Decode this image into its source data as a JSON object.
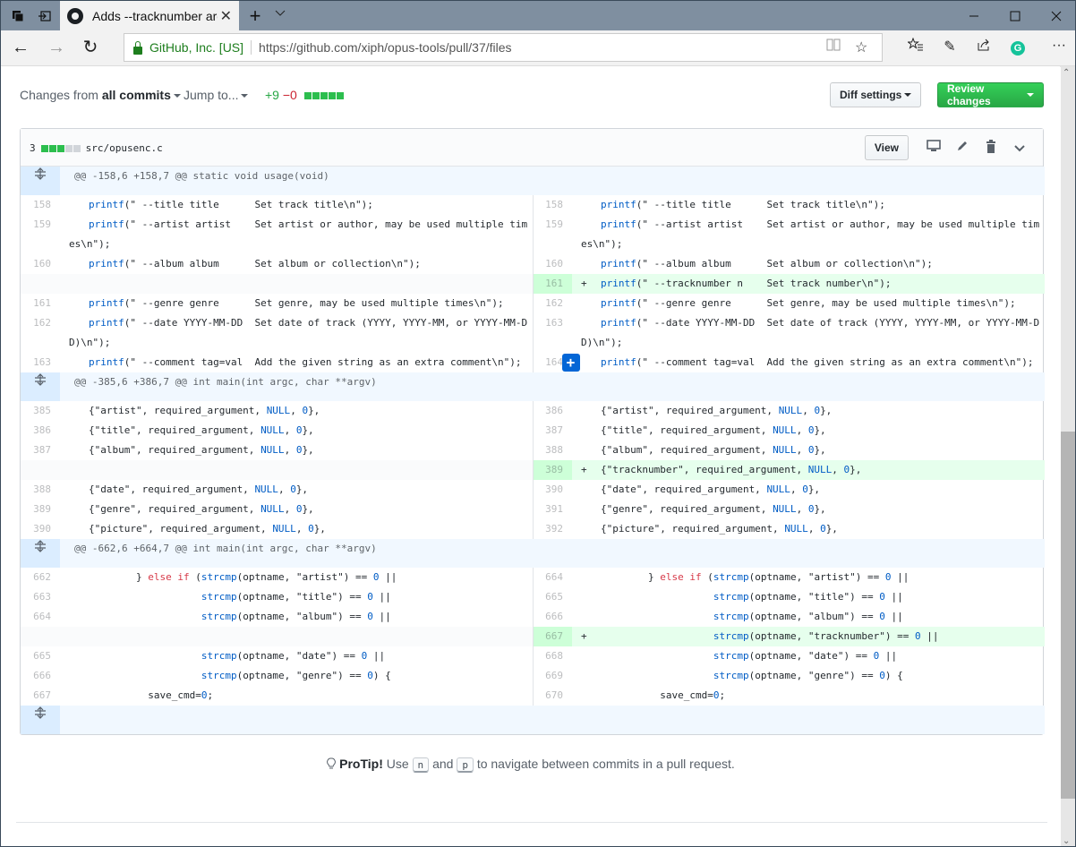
{
  "browser": {
    "tab_title": "Adds --tracknumber arg",
    "cert_label": "GitHub, Inc. [US]",
    "url": "https://github.com/xiph/opus-tools/pull/37/files",
    "icons": {
      "tab_manager": "tab-manager-icon",
      "set_aside": "set-aside-icon",
      "new_tab": "+",
      "tab_menu": "∨",
      "minimize": "—",
      "maximize": "□",
      "close": "✕",
      "back": "←",
      "forward": "→",
      "refresh": "↻",
      "reading_view": "📖",
      "favorite": "☆",
      "favorites_hub": "★",
      "notes": "✎",
      "share": "↪",
      "grammarly": "G",
      "more": "···"
    }
  },
  "toolbar": {
    "changes_prefix": "Changes from",
    "changes_value": "all commits",
    "jump_to": "Jump to...",
    "additions": "+9",
    "deletions": "−0",
    "diff_settings": "Diff settings",
    "review_changes": "Review changes"
  },
  "file": {
    "change_count": "3",
    "path": "src/opusenc.c",
    "view_button": "View",
    "stat_blocks": {
      "added": 3,
      "neutral": 2
    }
  },
  "hunks": [
    {
      "header": "@@ -158,6 +158,7 @@ static void usage(void)",
      "rows": [
        {
          "l": "158",
          "lc": [
            [
              "kw",
              "printf"
            ],
            [
              "",
              "(\" --title title      Set track title\\n\");"
            ]
          ],
          "r": "158",
          "rc": [
            [
              "kw",
              "printf"
            ],
            [
              "",
              "(\" --title title      Set track title\\n\");"
            ]
          ],
          "type": "ctx"
        },
        {
          "l": "159",
          "lc": [
            [
              "kw",
              "printf"
            ],
            [
              "",
              "(\" --artist artist    Set artist or author, may be used multiple times\\n\");"
            ]
          ],
          "r": "159",
          "rc": [
            [
              "kw",
              "printf"
            ],
            [
              "",
              "(\" --artist artist    Set artist or author, may be used multiple times\\n\");"
            ]
          ],
          "type": "ctx"
        },
        {
          "l": "160",
          "lc": [
            [
              "kw",
              "printf"
            ],
            [
              "",
              "(\" --album album      Set album or collection\\n\");"
            ]
          ],
          "r": "160",
          "rc": [
            [
              "kw",
              "printf"
            ],
            [
              "",
              "(\" --album album      Set album or collection\\n\");"
            ]
          ],
          "type": "ctx"
        },
        {
          "l": "",
          "lc": [],
          "r": "161",
          "rc": [
            [
              "kw",
              "printf"
            ],
            [
              "",
              "(\" --tracknumber n    Set track number\\n\");"
            ]
          ],
          "type": "add"
        },
        {
          "l": "161",
          "lc": [
            [
              "kw",
              "printf"
            ],
            [
              "",
              "(\" --genre genre      Set genre, may be used multiple times\\n\");"
            ]
          ],
          "r": "162",
          "rc": [
            [
              "kw",
              "printf"
            ],
            [
              "",
              "(\" --genre genre      Set genre, may be used multiple times\\n\");"
            ]
          ],
          "type": "ctx"
        },
        {
          "l": "162",
          "lc": [
            [
              "kw",
              "printf"
            ],
            [
              "",
              "(\" --date YYYY-MM-DD  Set date of track (YYYY, YYYY-MM, or YYYY-MM-DD)\\n\");"
            ]
          ],
          "r": "163",
          "rc": [
            [
              "kw",
              "printf"
            ],
            [
              "",
              "(\" --date YYYY-MM-DD  Set date of track (YYYY, YYYY-MM, or YYYY-MM-DD)\\n\");"
            ]
          ],
          "type": "ctx"
        },
        {
          "l": "163",
          "lc": [
            [
              "kw",
              "printf"
            ],
            [
              "",
              "(\" --comment tag=val  Add the given string as an extra comment\\n\");"
            ]
          ],
          "r": "164",
          "rc": [
            [
              "kw",
              "printf"
            ],
            [
              "",
              "(\" --comment tag=val  Add the given string as an extra comment\\n\");"
            ]
          ],
          "type": "ctx",
          "hover": true
        }
      ]
    },
    {
      "header": "@@ -385,6 +386,7 @@ int main(int argc, char **argv)",
      "rows": [
        {
          "l": "385",
          "lc": [
            [
              "",
              "{\"artist\", required_argument, "
            ],
            [
              "kw",
              "NULL"
            ],
            [
              "",
              ", "
            ],
            [
              "kw",
              "0"
            ],
            [
              "",
              "},"
            ]
          ],
          "r": "386",
          "rc": [
            [
              "",
              "{\"artist\", required_argument, "
            ],
            [
              "kw",
              "NULL"
            ],
            [
              "",
              ", "
            ],
            [
              "kw",
              "0"
            ],
            [
              "",
              "},"
            ]
          ],
          "type": "ctx"
        },
        {
          "l": "386",
          "lc": [
            [
              "",
              "{\"title\", required_argument, "
            ],
            [
              "kw",
              "NULL"
            ],
            [
              "",
              ", "
            ],
            [
              "kw",
              "0"
            ],
            [
              "",
              "},"
            ]
          ],
          "r": "387",
          "rc": [
            [
              "",
              "{\"title\", required_argument, "
            ],
            [
              "kw",
              "NULL"
            ],
            [
              "",
              ", "
            ],
            [
              "kw",
              "0"
            ],
            [
              "",
              "},"
            ]
          ],
          "type": "ctx"
        },
        {
          "l": "387",
          "lc": [
            [
              "",
              "{\"album\", required_argument, "
            ],
            [
              "kw",
              "NULL"
            ],
            [
              "",
              ", "
            ],
            [
              "kw",
              "0"
            ],
            [
              "",
              "},"
            ]
          ],
          "r": "388",
          "rc": [
            [
              "",
              "{\"album\", required_argument, "
            ],
            [
              "kw",
              "NULL"
            ],
            [
              "",
              ", "
            ],
            [
              "kw",
              "0"
            ],
            [
              "",
              "},"
            ]
          ],
          "type": "ctx"
        },
        {
          "l": "",
          "lc": [],
          "r": "389",
          "rc": [
            [
              "",
              "{\"tracknumber\", required_argument, "
            ],
            [
              "kw",
              "NULL"
            ],
            [
              "",
              ", "
            ],
            [
              "kw",
              "0"
            ],
            [
              "",
              "},"
            ]
          ],
          "type": "add"
        },
        {
          "l": "388",
          "lc": [
            [
              "",
              "{\"date\", required_argument, "
            ],
            [
              "kw",
              "NULL"
            ],
            [
              "",
              ", "
            ],
            [
              "kw",
              "0"
            ],
            [
              "",
              "},"
            ]
          ],
          "r": "390",
          "rc": [
            [
              "",
              "{\"date\", required_argument, "
            ],
            [
              "kw",
              "NULL"
            ],
            [
              "",
              ", "
            ],
            [
              "kw",
              "0"
            ],
            [
              "",
              "},"
            ]
          ],
          "type": "ctx"
        },
        {
          "l": "389",
          "lc": [
            [
              "",
              "{\"genre\", required_argument, "
            ],
            [
              "kw",
              "NULL"
            ],
            [
              "",
              ", "
            ],
            [
              "kw",
              "0"
            ],
            [
              "",
              "},"
            ]
          ],
          "r": "391",
          "rc": [
            [
              "",
              "{\"genre\", required_argument, "
            ],
            [
              "kw",
              "NULL"
            ],
            [
              "",
              ", "
            ],
            [
              "kw",
              "0"
            ],
            [
              "",
              "},"
            ]
          ],
          "type": "ctx"
        },
        {
          "l": "390",
          "lc": [
            [
              "",
              "{\"picture\", required_argument, "
            ],
            [
              "kw",
              "NULL"
            ],
            [
              "",
              ", "
            ],
            [
              "kw",
              "0"
            ],
            [
              "",
              "},"
            ]
          ],
          "r": "392",
          "rc": [
            [
              "",
              "{\"picture\", required_argument, "
            ],
            [
              "kw",
              "NULL"
            ],
            [
              "",
              ", "
            ],
            [
              "kw",
              "0"
            ],
            [
              "",
              "},"
            ]
          ],
          "type": "ctx"
        }
      ]
    },
    {
      "header": "@@ -662,6 +664,7 @@ int main(int argc, char **argv)",
      "rows": [
        {
          "l": "662",
          "lc": [
            [
              "",
              "        } "
            ],
            [
              "red",
              "else if"
            ],
            [
              "",
              " ("
            ],
            [
              "kw",
              "strcmp"
            ],
            [
              "",
              "(optname, \"artist\") == "
            ],
            [
              "kw",
              "0"
            ],
            [
              "",
              " ||"
            ]
          ],
          "r": "664",
          "rc": [
            [
              "",
              "        } "
            ],
            [
              "red",
              "else if"
            ],
            [
              "",
              " ("
            ],
            [
              "kw",
              "strcmp"
            ],
            [
              "",
              "(optname, \"artist\") == "
            ],
            [
              "kw",
              "0"
            ],
            [
              "",
              " ||"
            ]
          ],
          "type": "ctx"
        },
        {
          "l": "663",
          "lc": [
            [
              "",
              "                   "
            ],
            [
              "kw",
              "strcmp"
            ],
            [
              "",
              "(optname, \"title\") == "
            ],
            [
              "kw",
              "0"
            ],
            [
              "",
              " ||"
            ]
          ],
          "r": "665",
          "rc": [
            [
              "",
              "                   "
            ],
            [
              "kw",
              "strcmp"
            ],
            [
              "",
              "(optname, \"title\") == "
            ],
            [
              "kw",
              "0"
            ],
            [
              "",
              " ||"
            ]
          ],
          "type": "ctx"
        },
        {
          "l": "664",
          "lc": [
            [
              "",
              "                   "
            ],
            [
              "kw",
              "strcmp"
            ],
            [
              "",
              "(optname, \"album\") == "
            ],
            [
              "kw",
              "0"
            ],
            [
              "",
              " ||"
            ]
          ],
          "r": "666",
          "rc": [
            [
              "",
              "                   "
            ],
            [
              "kw",
              "strcmp"
            ],
            [
              "",
              "(optname, \"album\") == "
            ],
            [
              "kw",
              "0"
            ],
            [
              "",
              " ||"
            ]
          ],
          "type": "ctx"
        },
        {
          "l": "",
          "lc": [],
          "r": "667",
          "rc": [
            [
              "",
              "                   "
            ],
            [
              "kw",
              "strcmp"
            ],
            [
              "",
              "(optname, \"tracknumber\") == "
            ],
            [
              "kw",
              "0"
            ],
            [
              "",
              " ||"
            ]
          ],
          "type": "add"
        },
        {
          "l": "665",
          "lc": [
            [
              "",
              "                   "
            ],
            [
              "kw",
              "strcmp"
            ],
            [
              "",
              "(optname, \"date\") == "
            ],
            [
              "kw",
              "0"
            ],
            [
              "",
              " ||"
            ]
          ],
          "r": "668",
          "rc": [
            [
              "",
              "                   "
            ],
            [
              "kw",
              "strcmp"
            ],
            [
              "",
              "(optname, \"date\") == "
            ],
            [
              "kw",
              "0"
            ],
            [
              "",
              " ||"
            ]
          ],
          "type": "ctx"
        },
        {
          "l": "666",
          "lc": [
            [
              "",
              "                   "
            ],
            [
              "kw",
              "strcmp"
            ],
            [
              "",
              "(optname, \"genre\") == "
            ],
            [
              "kw",
              "0"
            ],
            [
              "",
              ") {"
            ]
          ],
          "r": "669",
          "rc": [
            [
              "",
              "                   "
            ],
            [
              "kw",
              "strcmp"
            ],
            [
              "",
              "(optname, \"genre\") == "
            ],
            [
              "kw",
              "0"
            ],
            [
              "",
              ") {"
            ]
          ],
          "type": "ctx"
        },
        {
          "l": "667",
          "lc": [
            [
              "",
              "          save_cmd="
            ],
            [
              "kw",
              "0"
            ],
            [
              "",
              ";"
            ]
          ],
          "r": "670",
          "rc": [
            [
              "",
              "          save_cmd="
            ],
            [
              "kw",
              "0"
            ],
            [
              "",
              ";"
            ]
          ],
          "type": "ctx"
        }
      ]
    }
  ],
  "protip": {
    "label": "ProTip!",
    "text1": "Use",
    "key1": "n",
    "text2": "and",
    "key2": "p",
    "text3": "to navigate between commits in a pull request."
  },
  "colors": {
    "addition": "#28a745",
    "deletion": "#cb2431",
    "primary_button": "#2cbe4e",
    "keyword": "#005cc5",
    "else_if": "#d73a49",
    "added_line_bg": "#e6ffed",
    "hunk_bg": "#f1f8ff"
  }
}
